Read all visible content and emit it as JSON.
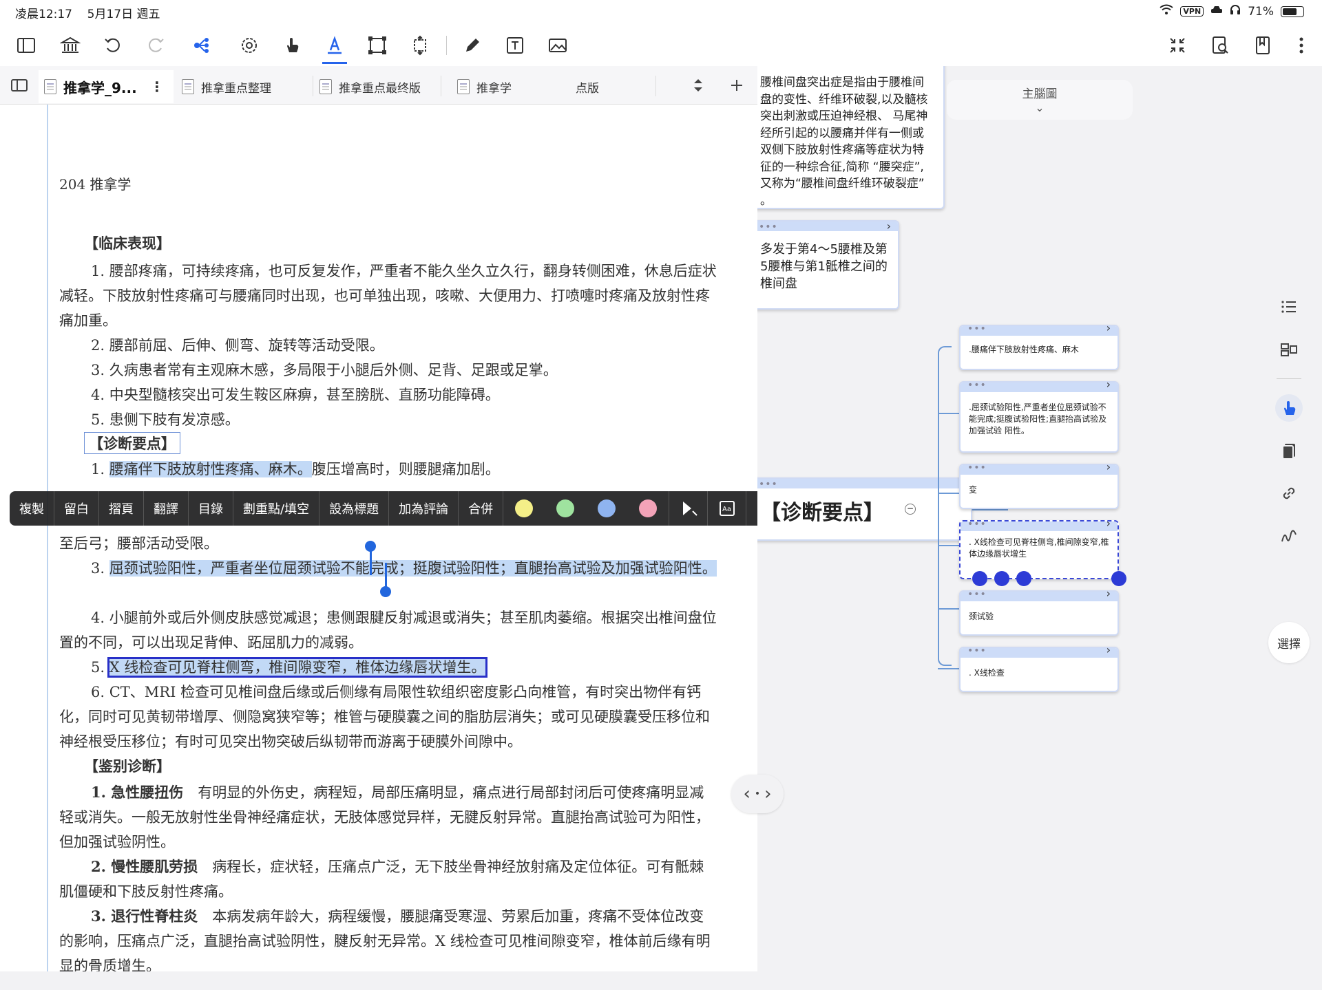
{
  "status": {
    "time": "凌晨12:17",
    "date": "5月17日 週五",
    "vpn": "VPN",
    "battery": "71%",
    "battery_level": 0.71
  },
  "tabs": [
    {
      "label": "推拿学_9...",
      "active": true
    },
    {
      "label": "推拿重点整理"
    },
    {
      "label": "推拿重点最终版"
    },
    {
      "label": "推拿学"
    },
    {
      "label": "点版"
    }
  ],
  "doc": {
    "page_header": "204   推拿学",
    "section1": "【临床表现】",
    "p1": "1. 腰部疼痛，可持续疼痛，也可反复发作，严重者不能久坐久立久行，翻身转侧困难，休息后症状减轻。下肢放射性疼痛可与腰痛同时出现，也可单独出现，咳嗽、大便用力、打喷嚏时疼痛及放射性疼痛加重。",
    "p2": "2. 腰部前屈、后伸、侧弯、旋转等活动受限。",
    "p3": "3. 久病患者常有主观麻木感，多局限于小腿后外侧、足背、足跟或足掌。",
    "p4": "4. 中央型髓核突出可发生鞍区麻痹，甚至膀胱、直肠功能障碍。",
    "p5": "5. 患侧下肢有发凉感。",
    "section2": "【诊断要点】",
    "d1_num": "1. ",
    "d1_hl": "腰痛伴下肢放射性疼痛、麻木。",
    "d1_rest": "腹压增高时，则腰腿痛加剧。",
    "d2_tail": "至后弓；腰部活动受限。",
    "d3_num": "3. ",
    "d3_hl": "屈颈试验阳性，严重者坐位屈颈试验不能完成；挺腹试验阳性；直腿抬高试验及加强试验阳性。",
    "d4": "4. 小腿前外或后外侧皮肤感觉减退；患侧跟腱反射减退或消失；甚至肌肉萎缩。根据突出椎间盘位置的不同，可以出现足背伸、跖屈肌力的减弱。",
    "d5_num": "5. ",
    "d5_hl": "X 线检查可见脊柱侧弯，椎间隙变窄，椎体边缘唇状增生。",
    "d6": "6. CT、MRI 检查可见椎间盘后缘或后侧缘有局限性软组织密度影凸向椎管，有时突出物伴有钙化，同时可见黄韧带增厚、侧隐窝狭窄等；椎管与硬膜囊之间的脂肪层消失；或可见硬膜囊受压移位和神经根受压移位；有时可见突出物突破后纵韧带而游离于硬膜外间隙中。",
    "section3": "【鉴别诊断】",
    "e1_b": "1. 急性腰扭伤",
    "e1": "　有明显的外伤史，病程短，局部压痛明显，痛点进行局部封闭后可使疼痛明显减轻或消失。一般无放射性坐骨神经痛症状，无肢体感觉异样，无腱反射异常。直腿抬高试验可为阳性，但加强试验阴性。",
    "e2_b": "2. 慢性腰肌劳损",
    "e2": "　病程长，症状轻，压痛点广泛，无下肢坐骨神经放射痛及定位体征。可有骶棘肌僵硬和下肢反射性疼痛。",
    "e3_b": "3. 退行性脊柱炎",
    "e3": "　本病发病年龄大，病程缓慢，腰腿痛受寒湿、劳累后加重，疼痛不受体位改变的影响，压痛点广泛，直腿抬高试验阴性，腱反射无异常。X 线检查可见椎间隙变窄，椎体前后缘有明显的骨质增生。"
  },
  "context_menu": {
    "items": [
      "複製",
      "留白",
      "摺頁",
      "翻譯",
      "目錄",
      "劃重點/填空",
      "設為標題",
      "加為評論",
      "合併"
    ],
    "colors": [
      "#f4ef88",
      "#9fe39f",
      "#8fb4f0",
      "#f3a3b8"
    ]
  },
  "mindmap": {
    "topic_chip": "主腦圖",
    "top_node": "腰椎间盘突出症是指由于腰椎间盘的变性、纤维环破裂,以及髓核突出刺激或压迫神经根、 马尾神经所引起的以腰痛并伴有一侧或双侧下肢放射性疼痛等症状为特征的一种综合征,简称 “腰突症”,又称为“腰椎间盘纤维环破裂症” 。",
    "node2": "多发于第4～5腰椎及第5腰椎与第1骶椎之间的椎间盘",
    "center_node": "【诊断要点】",
    "children": [
      ".腰痛伴下肢放射性疼痛、麻木",
      ".屈颈试验阳性,严重者坐位屈颈试验不能完成;挺腹试验阳性;直腿抬高试验及加强试验 阳性。",
      "变",
      ". X线检查可见脊柱侧弯,椎间隙变窄,椎体边缘唇状增生",
      "颈试验",
      ". X线检查"
    ],
    "select_button": "選擇"
  }
}
